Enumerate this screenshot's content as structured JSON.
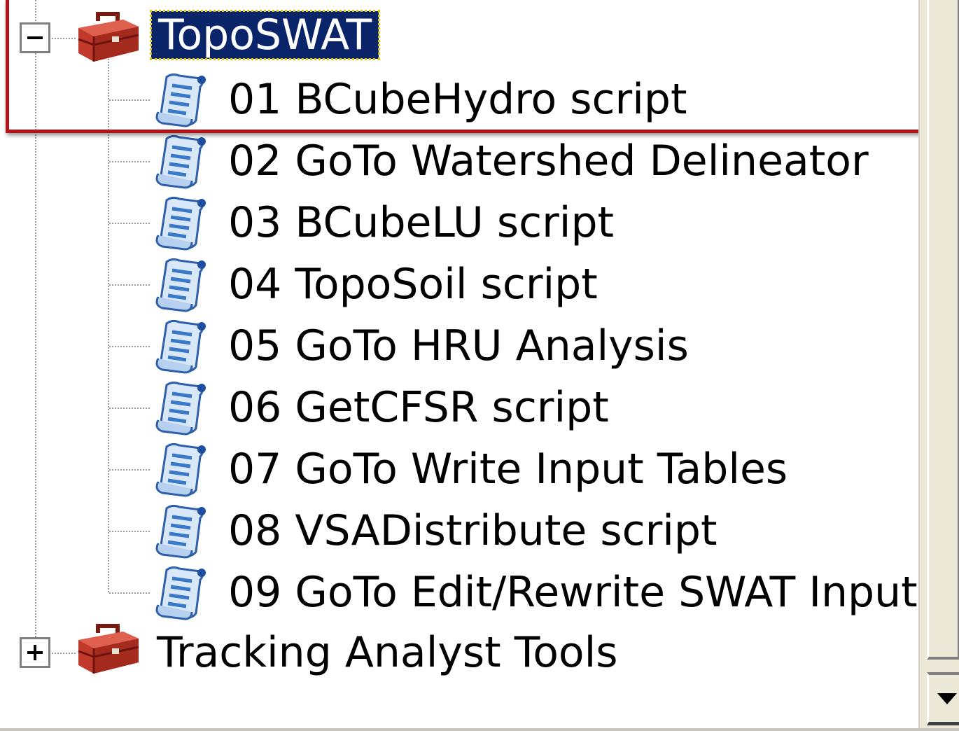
{
  "tree": {
    "root_toolbox": {
      "label": "TopoSWAT",
      "expander": "minus",
      "selected": true,
      "icon": "toolbox-icon"
    },
    "scripts": [
      {
        "label": "01 BCubeHydro script",
        "icon": "script-icon"
      },
      {
        "label": "02 GoTo Watershed Delineator",
        "icon": "script-icon"
      },
      {
        "label": "03 BCubeLU script",
        "icon": "script-icon"
      },
      {
        "label": "04 TopoSoil script",
        "icon": "script-icon"
      },
      {
        "label": "05 GoTo HRU Analysis",
        "icon": "script-icon"
      },
      {
        "label": "06 GetCFSR script",
        "icon": "script-icon"
      },
      {
        "label": "07 GoTo Write Input Tables",
        "icon": "script-icon"
      },
      {
        "label": "08 VSADistribute script",
        "icon": "script-icon"
      },
      {
        "label": "09 GoTo Edit/Rewrite SWAT Input",
        "icon": "script-icon"
      }
    ],
    "second_toolbox": {
      "label": "Tracking Analyst Tools",
      "expander": "plus",
      "icon": "toolbox-icon"
    }
  },
  "colors": {
    "selection_bg": "#0a246a",
    "selection_text": "#ffffff",
    "highlight_border": "#b3141a",
    "toolbox_red": "#c0392b",
    "script_blue": "#3a78c8"
  },
  "scrollbar": {
    "icon": "scroll-down-arrow-icon"
  }
}
